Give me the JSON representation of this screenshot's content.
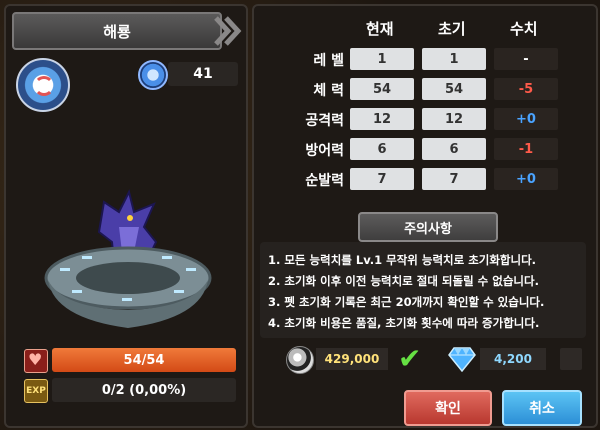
{
  "pet": {
    "name": "해룡",
    "level": "41",
    "hp_text": "54/54",
    "hp_fraction": 1.0,
    "exp_text": "0/2 (0,00%)",
    "exp_fraction": 0.0
  },
  "stats": {
    "headers": [
      "현재",
      "초기",
      "수치"
    ],
    "rows": [
      {
        "label": "레 벨",
        "current": "1",
        "initial": "1",
        "diff": "-",
        "type": "dash"
      },
      {
        "label": "체 력",
        "current": "54",
        "initial": "54",
        "diff": "-5",
        "type": "neg"
      },
      {
        "label": "공격력",
        "current": "12",
        "initial": "12",
        "diff": "+0",
        "type": "pos"
      },
      {
        "label": "방어력",
        "current": "6",
        "initial": "6",
        "diff": "-1",
        "type": "neg"
      },
      {
        "label": "순발력",
        "current": "7",
        "initial": "7",
        "diff": "+0",
        "type": "pos"
      }
    ]
  },
  "notice": {
    "title": "주의사항",
    "lines": [
      "1. 모든 능력치를 Lv.1 무작위 능력치로 초기화합니다.",
      "2. 초기화 이후 이전 능력치로 절대 되돌릴 수 없습니다.",
      "3. 펫 초기화 기록은 최근 20개까지 확인할 수 있습니다.",
      "4. 초기화 비용은 품질, 초기화 횟수에 따라 증가합니다."
    ]
  },
  "cost": {
    "gold": "429,000",
    "gems": "4,200"
  },
  "buttons": {
    "confirm": "확인",
    "cancel": "취소"
  },
  "colors": {
    "negative": "#ff5a4a",
    "positive": "#4aa3ff",
    "confirm_btn": "#c8463b",
    "cancel_btn": "#3aa0e4",
    "hp_bar": "#e05a24"
  }
}
